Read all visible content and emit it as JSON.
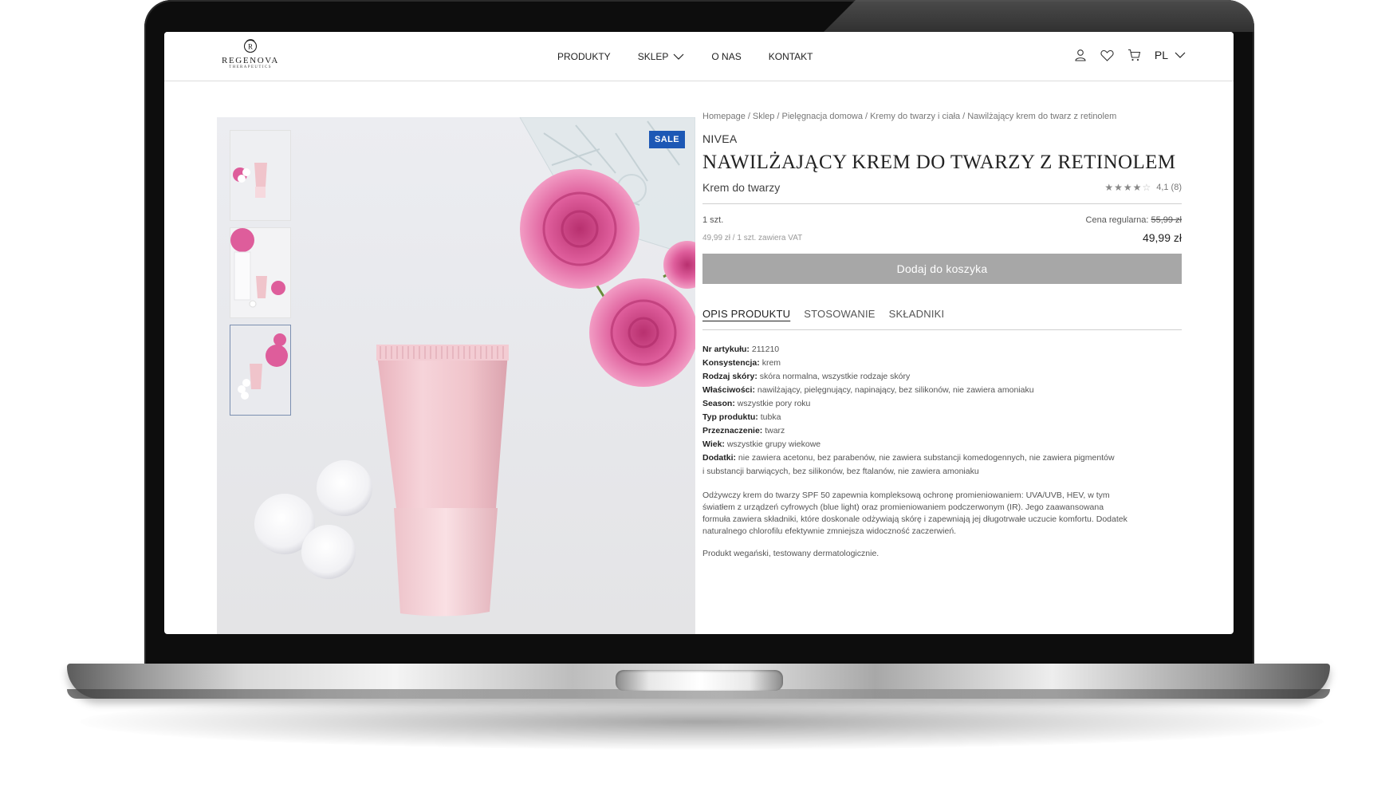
{
  "brand": {
    "name": "REGENOVA",
    "tagline": "THERAPEUTICS"
  },
  "nav": [
    {
      "label": "PRODUKTY"
    },
    {
      "label": "SKLEP"
    },
    {
      "label": "O NAS"
    },
    {
      "label": "KONTAKT"
    }
  ],
  "header_icons": [
    "user-icon",
    "heart-icon",
    "cart-icon"
  ],
  "language": "PL",
  "gallery": {
    "badge": "SALE",
    "thumbnail_count": 3,
    "active_thumbnail": 3
  },
  "product": {
    "breadcrumb": [
      "Homepage",
      "Sklep",
      "Pielęgnacja domowa",
      "Kremy do twarzy i ciała",
      "Nawilżający krem do twarz z retinolem"
    ],
    "manufacturer": "NIVEA",
    "title": "NAWILŻAJĄCY KREM DO TWARZY Z RETINOLEM",
    "subtitle": "Krem do twarzy",
    "rating_value": 4.1,
    "rating_text": "4,1 (8)",
    "quantity_label": "1 szt.",
    "regular_price_label": "Cena regularna:",
    "regular_price": "55,99 zł",
    "unit_price_note": "49,99 zł / 1 szt. zawiera VAT",
    "price": "49,99 zł",
    "add_to_cart": "Dodaj do koszyka"
  },
  "tabs": [
    {
      "label": "OPIS PRODUKTU",
      "active": true
    },
    {
      "label": "STOSOWANIE",
      "active": false
    },
    {
      "label": "SKŁADNIKI",
      "active": false
    }
  ],
  "attributes": [
    {
      "label": "Nr artykułu:",
      "value": "211210"
    },
    {
      "label": "Konsystencja:",
      "value": "krem"
    },
    {
      "label": "Rodzaj skóry:",
      "value": "skóra normalna, wszystkie rodzaje skóry"
    },
    {
      "label": "Właściwości:",
      "value": "nawilżający, pielęgnujący, napinający, bez silikonów, nie zawiera amoniaku"
    },
    {
      "label": "Season:",
      "value": "wszystkie pory roku"
    },
    {
      "label": "Typ produktu:",
      "value": "tubka"
    },
    {
      "label": "Przeznaczenie:",
      "value": "twarz"
    },
    {
      "label": "Wiek:",
      "value": "wszystkie grupy wiekowe"
    },
    {
      "label": "Dodatki:",
      "value": "nie zawiera acetonu, bez parabenów, nie zawiera substancji komedogennych, nie zawiera pigmentów i substancji barwiących, bez silikonów, bez ftalanów, nie zawiera amoniaku"
    }
  ],
  "description": "Odżywczy krem do twarzy SPF 50 zapewnia kompleksową ochronę promieniowaniem: UVA/UVB, HEV, w tym światłem z urządzeń cyfrowych (blue light) oraz promieniowaniem podczerwonym (IR). Jego zaawansowana formuła zawiera składniki, które doskonale odżywiają skórę i zapewniają jej długotrwałe uczucie komfortu. Dodatek naturalnego chlorofilu efektywnie zmniejsza widoczność zaczerwień.",
  "description_note": "Produkt wegański, testowany dermatologicznie.",
  "colors": {
    "accent_badge": "#1d58b5",
    "button_disabled": "#a7a7a7",
    "product_pink": "#f0c4cb",
    "flower_pink": "#d94f93"
  }
}
